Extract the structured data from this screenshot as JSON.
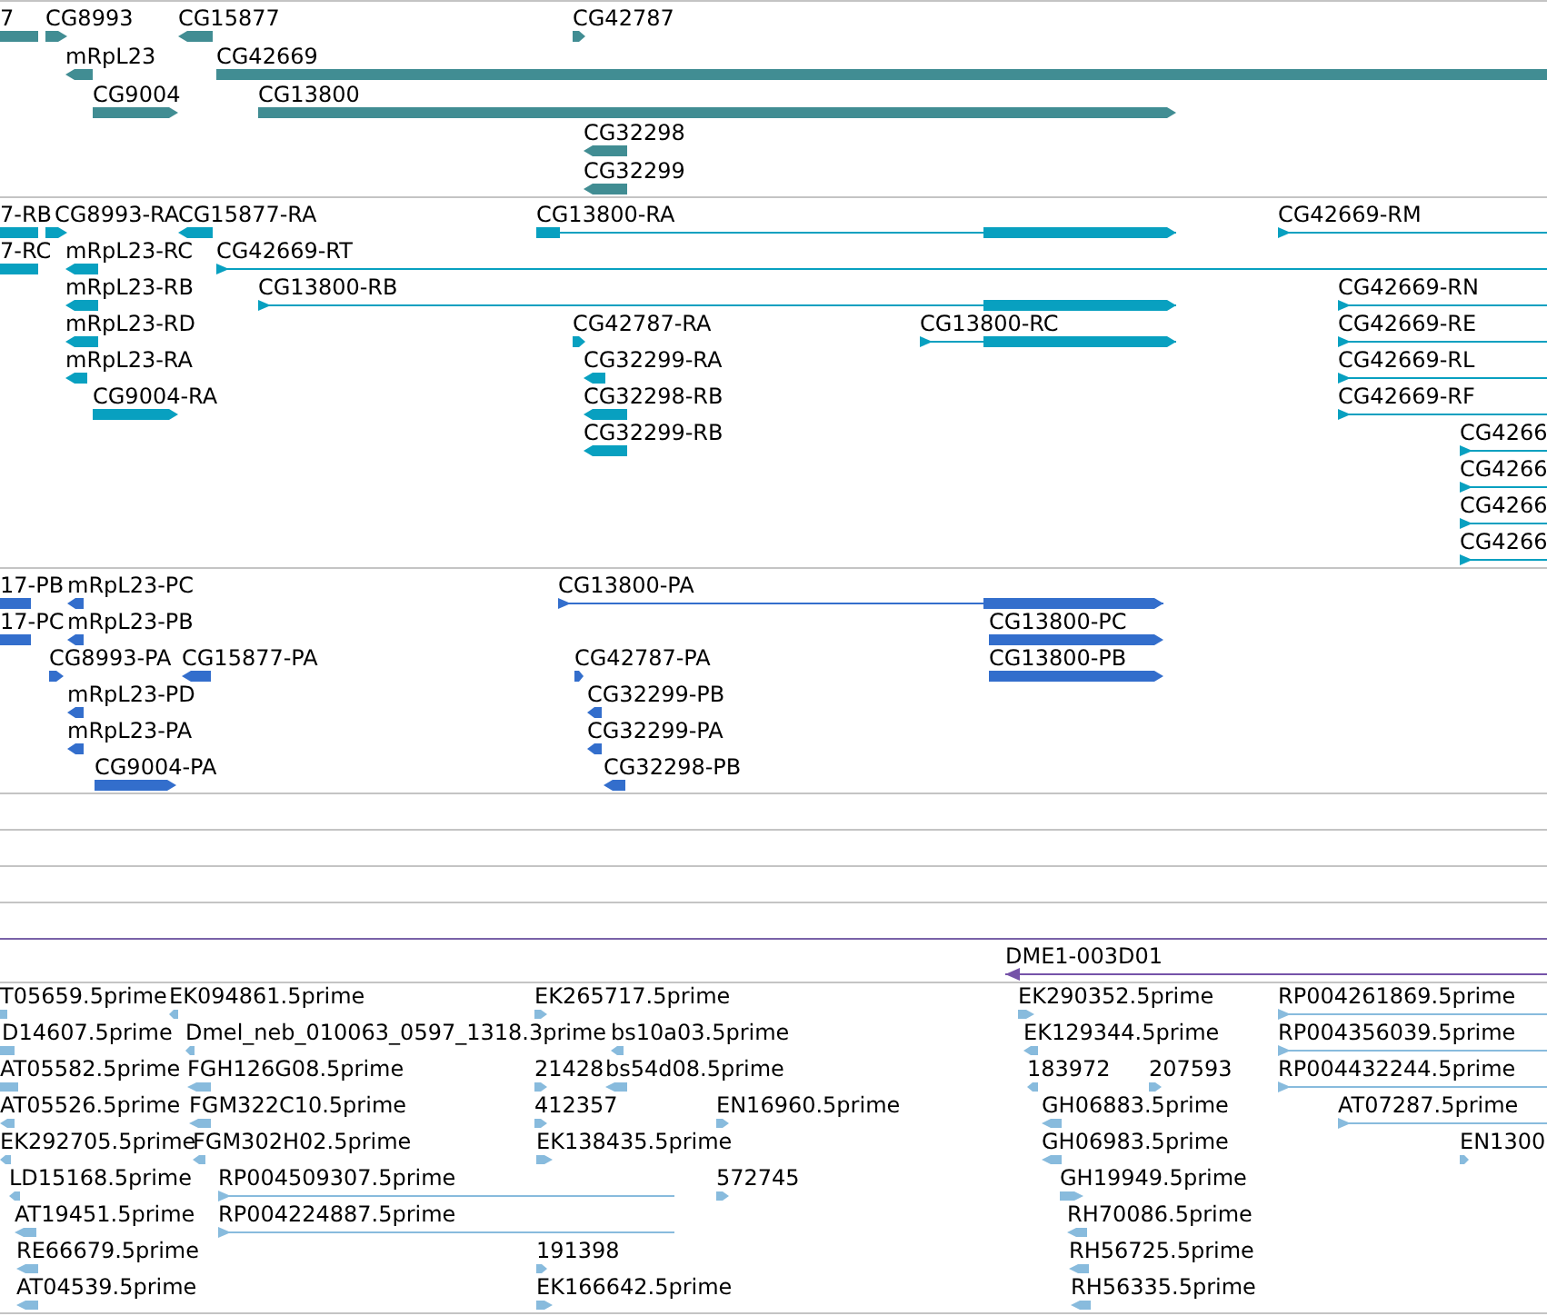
{
  "tracks": [
    {
      "color": "#418d93",
      "features": [
        {
          "label": "7"
        },
        {
          "label": "CG8993",
          "reverse": false
        },
        {
          "label": "CG15877",
          "reverse": true
        },
        {
          "label": "CG42787",
          "reverse": false
        },
        {
          "label": "mRpL23",
          "reverse": true
        },
        {
          "label": "CG42669"
        },
        {
          "label": "CG9004",
          "reverse": false
        },
        {
          "label": "CG13800",
          "reverse": false
        },
        {
          "label": "CG32298",
          "reverse": true
        },
        {
          "label": "CG32299",
          "reverse": true
        }
      ]
    },
    {
      "color": "#08a0c0",
      "features": [
        {
          "label": "7-RB"
        },
        {
          "label": "CG8993-RA",
          "reverse": false
        },
        {
          "label": "CG15877-RA",
          "reverse": true
        },
        {
          "label": "CG13800-RA",
          "reverse": false
        },
        {
          "label": "CG42669-RM",
          "reverse": false
        },
        {
          "label": "7-RC"
        },
        {
          "label": "mRpL23-RC",
          "reverse": true
        },
        {
          "label": "CG42669-RT",
          "reverse": false
        },
        {
          "label": "mRpL23-RB",
          "reverse": true
        },
        {
          "label": "CG13800-RB",
          "reverse": false
        },
        {
          "label": "CG42669-RN",
          "reverse": false
        },
        {
          "label": "mRpL23-RD",
          "reverse": true
        },
        {
          "label": "CG42787-RA",
          "reverse": false
        },
        {
          "label": "CG13800-RC",
          "reverse": false
        },
        {
          "label": "CG42669-RE",
          "reverse": false
        },
        {
          "label": "mRpL23-RA",
          "reverse": true
        },
        {
          "label": "CG32299-RA",
          "reverse": true
        },
        {
          "label": "CG42669-RL",
          "reverse": false
        },
        {
          "label": "CG9004-RA",
          "reverse": false
        },
        {
          "label": "CG32298-RB",
          "reverse": true
        },
        {
          "label": "CG42669-RF",
          "reverse": false
        },
        {
          "label": "CG32299-RB",
          "reverse": true
        },
        {
          "label": "CG4266",
          "reverse": false
        },
        {
          "label": "CG4266",
          "reverse": false
        },
        {
          "label": "CG4266",
          "reverse": false
        },
        {
          "label": "CG4266",
          "reverse": false
        }
      ]
    },
    {
      "color": "#336ecc",
      "features": [
        {
          "label": "17-PB"
        },
        {
          "label": "mRpL23-PC",
          "reverse": true
        },
        {
          "label": "CG13800-PA",
          "reverse": false
        },
        {
          "label": "17-PC"
        },
        {
          "label": "mRpL23-PB",
          "reverse": true
        },
        {
          "label": "CG13800-PC",
          "reverse": false
        },
        {
          "label": "CG8993-PA",
          "reverse": false
        },
        {
          "label": "CG15877-PA",
          "reverse": true
        },
        {
          "label": "CG42787-PA",
          "reverse": false
        },
        {
          "label": "CG13800-PB",
          "reverse": false
        },
        {
          "label": "mRpL23-PD",
          "reverse": true
        },
        {
          "label": "CG32299-PB",
          "reverse": true
        },
        {
          "label": "mRpL23-PA",
          "reverse": true
        },
        {
          "label": "CG32299-PA",
          "reverse": true
        },
        {
          "label": "CG9004-PA",
          "reverse": false
        },
        {
          "label": "CG32298-PB",
          "reverse": true
        }
      ]
    },
    {
      "color": "#7552a8",
      "features": [
        {
          "label": "DME1-003D01",
          "reverse": true
        }
      ]
    },
    {
      "color": "#88bbdd",
      "features": [
        {
          "label": "T05659.5prime"
        },
        {
          "label": "EK094861.5prime",
          "reverse": true
        },
        {
          "label": "EK265717.5prime",
          "reverse": false
        },
        {
          "label": "EK290352.5prime",
          "reverse": false
        },
        {
          "label": "RP004261869.5prime",
          "reverse": false
        },
        {
          "label": "D14607.5prime"
        },
        {
          "label": "Dmel_neb_010063_0597_1318.3prime",
          "reverse": true
        },
        {
          "label": "bs10a03.5prime",
          "reverse": true
        },
        {
          "label": "EK129344.5prime",
          "reverse": true
        },
        {
          "label": "RP004356039.5prime",
          "reverse": false
        },
        {
          "label": "AT05582.5prime"
        },
        {
          "label": "FGH126G08.5prime",
          "reverse": true
        },
        {
          "label": "21428",
          "reverse": false
        },
        {
          "label": "bs54d08.5prime",
          "reverse": true
        },
        {
          "label": "183972",
          "reverse": true
        },
        {
          "label": "207593",
          "reverse": false
        },
        {
          "label": "RP004432244.5prime",
          "reverse": false
        },
        {
          "label": "AT05526.5prime",
          "reverse": true
        },
        {
          "label": "FGM322C10.5prime",
          "reverse": true
        },
        {
          "label": "412357",
          "reverse": false
        },
        {
          "label": "EN16960.5prime",
          "reverse": false
        },
        {
          "label": "GH06883.5prime",
          "reverse": true
        },
        {
          "label": "AT07287.5prime",
          "reverse": false
        },
        {
          "label": "EK292705.5prime",
          "reverse": true
        },
        {
          "label": "FGM302H02.5prime",
          "reverse": true
        },
        {
          "label": "EK138435.5prime",
          "reverse": false
        },
        {
          "label": "GH06983.5prime",
          "reverse": true
        },
        {
          "label": "EN1300",
          "reverse": false
        },
        {
          "label": "LD15168.5prime",
          "reverse": true
        },
        {
          "label": "RP004509307.5prime",
          "reverse": false
        },
        {
          "label": "572745",
          "reverse": false
        },
        {
          "label": "GH19949.5prime",
          "reverse": false
        },
        {
          "label": "AT19451.5prime",
          "reverse": true
        },
        {
          "label": "RP004224887.5prime",
          "reverse": false
        },
        {
          "label": "RH70086.5prime",
          "reverse": true
        },
        {
          "label": "RE66679.5prime",
          "reverse": true
        },
        {
          "label": "191398",
          "reverse": false
        },
        {
          "label": "RH56725.5prime",
          "reverse": true
        },
        {
          "label": "AT04539.5prime",
          "reverse": true
        },
        {
          "label": "EK166642.5prime",
          "reverse": false
        },
        {
          "label": "RH56335.5prime",
          "reverse": true
        }
      ]
    }
  ]
}
